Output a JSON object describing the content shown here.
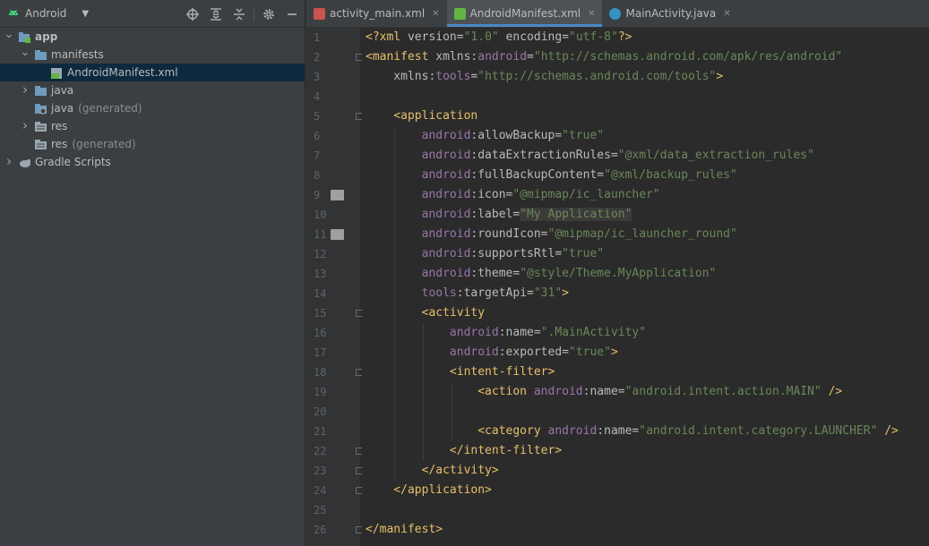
{
  "project": {
    "view_label": "Android",
    "tree": [
      {
        "label": "app",
        "hint": "",
        "depth": 0,
        "expanded": true,
        "kind": "module",
        "bold": true,
        "selected": false
      },
      {
        "label": "manifests",
        "hint": "",
        "depth": 1,
        "expanded": true,
        "kind": "folder",
        "bold": false,
        "selected": false
      },
      {
        "label": "AndroidManifest.xml",
        "hint": "",
        "depth": 2,
        "expanded": null,
        "kind": "manifest",
        "bold": false,
        "selected": true
      },
      {
        "label": "java",
        "hint": "",
        "depth": 1,
        "expanded": false,
        "kind": "folder",
        "bold": false,
        "selected": false
      },
      {
        "label": "java",
        "hint": "(generated)",
        "depth": 1,
        "expanded": null,
        "kind": "folder-gen",
        "bold": false,
        "selected": false
      },
      {
        "label": "res",
        "hint": "",
        "depth": 1,
        "expanded": false,
        "kind": "res",
        "bold": false,
        "selected": false
      },
      {
        "label": "res",
        "hint": "(generated)",
        "depth": 1,
        "expanded": null,
        "kind": "res",
        "bold": false,
        "selected": false
      },
      {
        "label": "Gradle Scripts",
        "hint": "",
        "depth": 0,
        "expanded": false,
        "kind": "gradle",
        "bold": false,
        "selected": false
      }
    ]
  },
  "tabs": [
    {
      "label": "activity_main.xml",
      "active": false,
      "icon": "layout-xml-icon"
    },
    {
      "label": "AndroidManifest.xml",
      "active": true,
      "icon": "manifest-icon"
    },
    {
      "label": "MainActivity.java",
      "active": false,
      "icon": "java-class-icon"
    }
  ],
  "line_numbers": [
    "1",
    "2",
    "3",
    "4",
    "5",
    "6",
    "7",
    "8",
    "9",
    "10",
    "11",
    "12",
    "13",
    "14",
    "15",
    "16",
    "17",
    "18",
    "19",
    "20",
    "21",
    "22",
    "23",
    "24",
    "25",
    "26"
  ],
  "code": [
    [
      [
        "p",
        "<?"
      ],
      [
        "t",
        "xml"
      ],
      [
        "at",
        " version="
      ],
      [
        "v",
        "\"1.0\""
      ],
      [
        "at",
        " encoding="
      ],
      [
        "v",
        "\"utf-8\""
      ],
      [
        "p",
        "?>"
      ]
    ],
    [
      [
        "t",
        "<manifest"
      ],
      [
        "at",
        " xmlns:"
      ],
      [
        "ns",
        "android"
      ],
      [
        "at",
        "="
      ],
      [
        "v",
        "\"http://schemas.android.com/apk/res/android\""
      ]
    ],
    [
      [
        "at",
        "    xmlns:"
      ],
      [
        "ns",
        "tools"
      ],
      [
        "at",
        "="
      ],
      [
        "v",
        "\"http://schemas.android.com/tools\""
      ],
      [
        "t",
        ">"
      ]
    ],
    [],
    [
      [
        "t",
        "    <application"
      ]
    ],
    [
      [
        "ns",
        "        android"
      ],
      [
        "at",
        ":allowBackup="
      ],
      [
        "v",
        "\"true\""
      ]
    ],
    [
      [
        "ns",
        "        android"
      ],
      [
        "at",
        ":dataExtractionRules="
      ],
      [
        "v",
        "\"@xml/data_extraction_rules\""
      ]
    ],
    [
      [
        "ns",
        "        android"
      ],
      [
        "at",
        ":fullBackupContent="
      ],
      [
        "v",
        "\"@xml/backup_rules\""
      ]
    ],
    [
      [
        "ns",
        "        android"
      ],
      [
        "at",
        ":icon="
      ],
      [
        "v",
        "\"@mipmap/ic_launcher\""
      ]
    ],
    [
      [
        "ns",
        "        android"
      ],
      [
        "at",
        ":label="
      ],
      [
        "hl",
        "\"My Application\""
      ]
    ],
    [
      [
        "ns",
        "        android"
      ],
      [
        "at",
        ":roundIcon="
      ],
      [
        "v",
        "\"@mipmap/ic_launcher_round\""
      ]
    ],
    [
      [
        "ns",
        "        android"
      ],
      [
        "at",
        ":supportsRtl="
      ],
      [
        "v",
        "\"true\""
      ]
    ],
    [
      [
        "ns",
        "        android"
      ],
      [
        "at",
        ":theme="
      ],
      [
        "v",
        "\"@style/Theme.MyApplication\""
      ]
    ],
    [
      [
        "ns",
        "        tools"
      ],
      [
        "at",
        ":targetApi="
      ],
      [
        "v",
        "\"31\""
      ],
      [
        "t",
        ">"
      ]
    ],
    [
      [
        "t",
        "        <activity"
      ]
    ],
    [
      [
        "ns",
        "            android"
      ],
      [
        "at",
        ":name="
      ],
      [
        "v",
        "\".MainActivity\""
      ]
    ],
    [
      [
        "ns",
        "            android"
      ],
      [
        "at",
        ":exported="
      ],
      [
        "v",
        "\"true\""
      ],
      [
        "t",
        ">"
      ]
    ],
    [
      [
        "t",
        "            <intent-filter>"
      ]
    ],
    [
      [
        "t",
        "                <action"
      ],
      [
        "ns",
        " android"
      ],
      [
        "at",
        ":name="
      ],
      [
        "v",
        "\"android.intent.action.MAIN\""
      ],
      [
        "t",
        " />"
      ]
    ],
    [],
    [
      [
        "t",
        "                <category"
      ],
      [
        "ns",
        " android"
      ],
      [
        "at",
        ":name="
      ],
      [
        "v",
        "\"android.intent.category.LAUNCHER\""
      ],
      [
        "t",
        " />"
      ]
    ],
    [
      [
        "t",
        "            </intent-filter>"
      ]
    ],
    [
      [
        "t",
        "        </activity>"
      ]
    ],
    [
      [
        "t",
        "    </application>"
      ]
    ],
    [],
    [
      [
        "t",
        "</manifest>"
      ]
    ]
  ],
  "fold_lines": [
    2,
    5,
    15,
    18,
    22,
    23,
    24,
    26
  ],
  "image_icon_lines": [
    9,
    11
  ]
}
